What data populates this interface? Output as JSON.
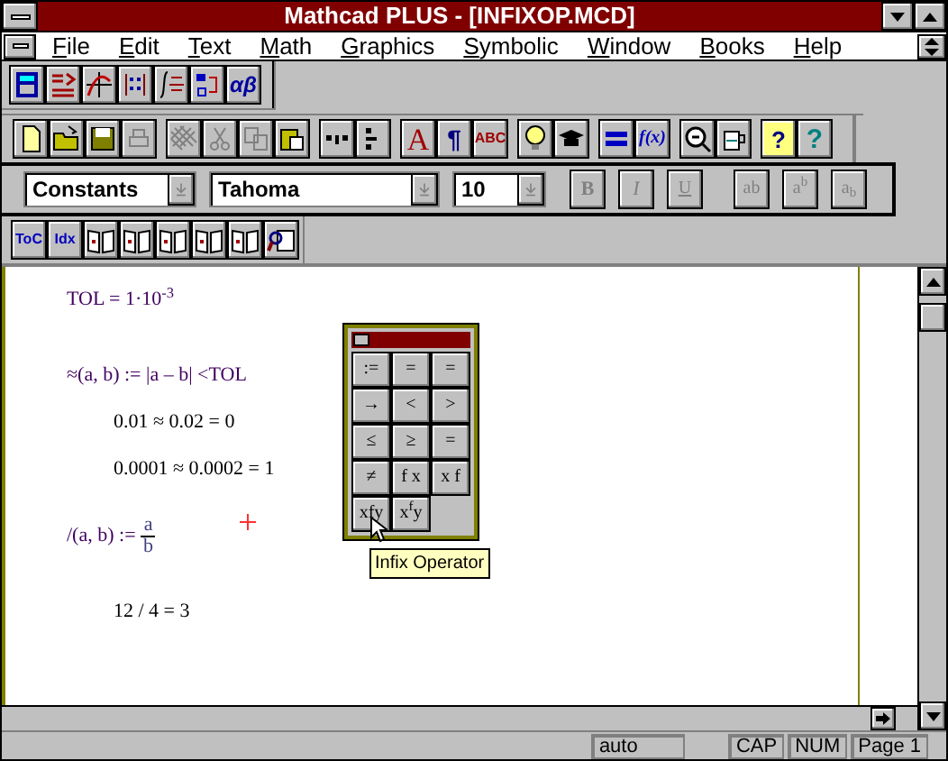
{
  "window": {
    "title": "Mathcad PLUS - [INFIXOP.MCD]"
  },
  "menu": [
    {
      "label": "File"
    },
    {
      "label": "Edit"
    },
    {
      "label": "Text"
    },
    {
      "label": "Math"
    },
    {
      "label": "Graphics"
    },
    {
      "label": "Symbolic"
    },
    {
      "label": "Window"
    },
    {
      "label": "Books"
    },
    {
      "label": "Help"
    }
  ],
  "palette_toolbar": {
    "labels": [
      "αβ"
    ]
  },
  "standard_toolbar": {
    "labels": [
      "A",
      "¶",
      "ABC",
      "f(x)",
      "?",
      "?"
    ]
  },
  "format_bar": {
    "style": "Constants",
    "font": "Tahoma",
    "size": "10",
    "buttons": [
      "B",
      "I",
      "U",
      "ab",
      "a$^{b}$",
      "a$_{b}$"
    ]
  },
  "math_toolbar": {
    "labels": [
      "ToC",
      "Idx"
    ]
  },
  "document": {
    "regions": [
      {
        "kind": "definition",
        "text": "TOL = 1·10$^{-3}$"
      },
      {
        "kind": "definition",
        "text": "≈(a, b) := |a – b| <TOL"
      },
      {
        "kind": "evaluation",
        "text": "0.01 ≈ 0.02 = 0"
      },
      {
        "kind": "evaluation",
        "text": "0.0001 ≈ 0.0002 = 1"
      },
      {
        "kind": "fraction",
        "lhs": "/(a, b) :=",
        "numerator": "a",
        "denominator": "b"
      },
      {
        "kind": "evaluation",
        "text": "12 / 4 = 3"
      }
    ]
  },
  "operator_palette": {
    "buttons": [
      ":=",
      "=",
      "=",
      "→",
      "<",
      ">",
      "≤",
      "≥",
      "=",
      "≠",
      "f x",
      "x f",
      "xfy",
      "x$^{f}$y"
    ]
  },
  "tooltip": "Infix Operator",
  "status_bar": [
    "auto",
    "CAP",
    "NUM",
    "Page 1"
  ]
}
